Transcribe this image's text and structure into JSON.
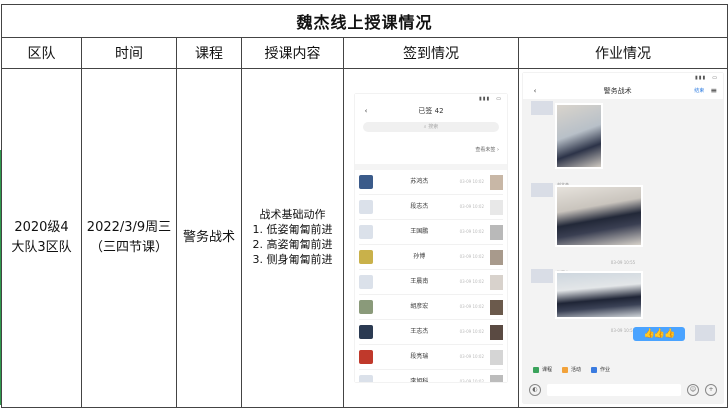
{
  "sheet": {
    "title": "魏杰线上授课情况",
    "headers": [
      "区队",
      "时间",
      "课程",
      "授课内容",
      "签到情况",
      "作业情况"
    ],
    "row": {
      "unit": "2020级4大队3区队",
      "time_line1": "2022/3/9周三",
      "time_line2": "（三四节课）",
      "course": "警务战术",
      "content_title": "战术基础动作",
      "content_items": [
        "1.  低姿匍匐前进",
        "2.  高姿匍匐前进",
        "3.  侧身匍匐前进"
      ]
    }
  },
  "checkin_screenshot": {
    "title": "已签 42",
    "search_placeholder": "搜索",
    "view_unsigned": "查看未签",
    "students": [
      {
        "name": "苏鸿杰",
        "time": "03-09 10:02"
      },
      {
        "name": "段志杰",
        "time": "03-09 10:02"
      },
      {
        "name": "王国鹏",
        "time": "03-09 10:02"
      },
      {
        "name": "孙博",
        "time": "03-09 10:02"
      },
      {
        "name": "王晨南",
        "time": "03-09 10:02"
      },
      {
        "name": "胡彦宏",
        "time": "03-09 10:02"
      },
      {
        "name": "王志杰",
        "time": "03-09 10:02"
      },
      {
        "name": "段亮瑞",
        "time": "03-09 10:02"
      },
      {
        "name": "李旭科",
        "time": "03-09 10:02"
      }
    ]
  },
  "homework_screenshot": {
    "title": "警务战术",
    "done_label": "结束",
    "senders": [
      "刘文杰",
      "张嘉文"
    ],
    "timestamps": [
      "03-09 10:55",
      "03-09 10:55"
    ],
    "reply": "👍👍👍",
    "tools": [
      "课程",
      "活动",
      "作业"
    ]
  },
  "colors": {
    "border": "#444444",
    "edge_accent": "#2e9a4c",
    "reply_bubble": "#4aa3ff",
    "link_blue": "#2f7de1"
  }
}
